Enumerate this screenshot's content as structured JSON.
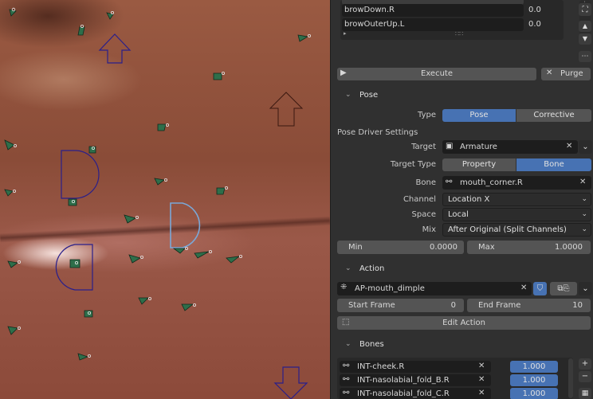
{
  "shape_keys": {
    "rows": [
      {
        "name": "browDown.R",
        "value": "0.0"
      },
      {
        "name": "browOuterUp.L",
        "value": "0.0"
      }
    ]
  },
  "execute_label": "Execute",
  "purge_label": "Purge",
  "pose_section": {
    "title": "Pose",
    "type_label": "Type",
    "type_options": [
      "Pose",
      "Corrective"
    ],
    "type_selected": "Pose",
    "driver_settings_label": "Pose Driver Settings",
    "target_label": "Target",
    "target_value": "Armature",
    "target_type_label": "Target Type",
    "target_type_options": [
      "Property",
      "Bone"
    ],
    "target_type_selected": "Bone",
    "bone_label": "Bone",
    "bone_value": "mouth_corner.R",
    "channel_label": "Channel",
    "channel_value": "Location X",
    "space_label": "Space",
    "space_value": "Local",
    "mix_label": "Mix",
    "mix_value": "After Original (Split Channels)",
    "min_label": "Min",
    "min_value": "0.0000",
    "max_label": "Max",
    "max_value": "1.0000"
  },
  "action_section": {
    "title": "Action",
    "action_name": "AP-mouth_dimple",
    "start_frame_label": "Start Frame",
    "start_frame_value": "0",
    "end_frame_label": "End Frame",
    "end_frame_value": "10",
    "edit_action_label": "Edit Action"
  },
  "bones_section": {
    "title": "Bones",
    "items": [
      {
        "name": "INT-cheek.R",
        "weight": "1.000"
      },
      {
        "name": "INT-nasolabial_fold_B.R",
        "weight": "1.000"
      },
      {
        "name": "INT-nasolabial_fold_C.R",
        "weight": "1.000"
      }
    ]
  },
  "colors": {
    "accent": "#4772b3",
    "panel_bg": "#303030",
    "field_bg": "#1d1d1d",
    "button_bg": "#545454",
    "control_dark_blue": "#2a1f8a",
    "control_light_blue": "#7aa8d8",
    "joint_green": "#2e6e4a"
  },
  "icons": {
    "header_expand": "chevron-down-icon",
    "play": "play-icon",
    "close": "close-icon",
    "armature": "armature-object-icon",
    "bone": "bone-icon",
    "action": "action-icon",
    "shield": "fake-user-shield-icon",
    "duplicate": "duplicate-icon",
    "edit_action": "edit-action-icon"
  }
}
